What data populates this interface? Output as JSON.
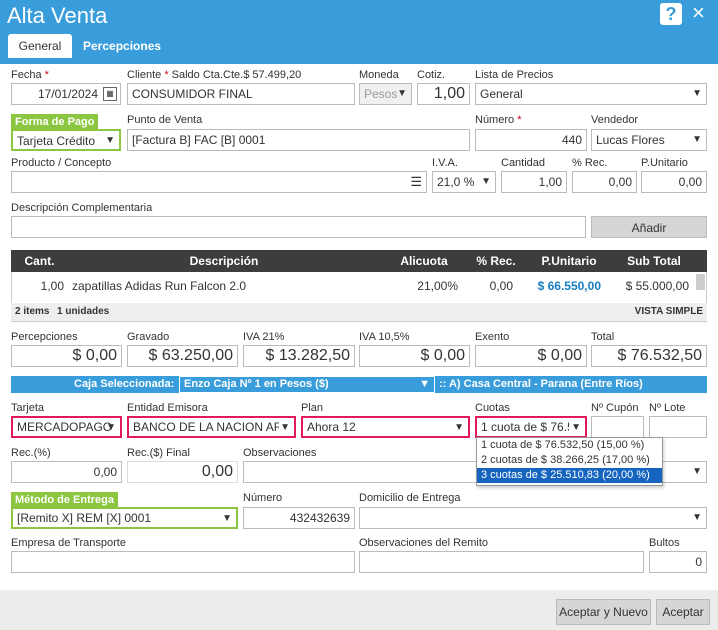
{
  "window": {
    "title": "Alta Venta",
    "help": "?",
    "close": "×"
  },
  "tabs": [
    "General",
    "Percepciones"
  ],
  "row1": {
    "fecha_label": "Fecha",
    "fecha_value": "17/01/2024",
    "cliente_label": "Cliente",
    "saldo": "Saldo Cta.Cte.$ 57.499,20",
    "cliente_value": "CONSUMIDOR FINAL",
    "moneda_label": "Moneda",
    "moneda_value": "Pesos",
    "cotiz_label": "Cotiz.",
    "cotiz_value": "1,00",
    "lista_label": "Lista de Precios",
    "lista_value": "General"
  },
  "row2": {
    "forma_label": "Forma de Pago",
    "forma_value": "Tarjeta Crédito",
    "pv_label": "Punto de Venta",
    "pv_value": "[Factura B] FAC [B] 0001",
    "numero_label": "Número",
    "numero_value": "440",
    "vendedor_label": "Vendedor",
    "vendedor_value": "Lucas Flores"
  },
  "row3": {
    "producto_label": "Producto / Concepto",
    "iva_label": "I.V.A.",
    "iva_value": "21,0 %",
    "cantidad_label": "Cantidad",
    "cantidad_value": "1,00",
    "rec_label": "% Rec.",
    "rec_value": "0,00",
    "punit_label": "P.Unitario",
    "punit_value": "0,00"
  },
  "row4": {
    "desc_label": "Descripción Complementaria",
    "add_button": "Añadir"
  },
  "table": {
    "headers": [
      "Cant.",
      "Descripción",
      "Alicuota",
      "% Rec.",
      "P.Unitario",
      "Sub Total"
    ],
    "rows": [
      {
        "cant": "1,00",
        "desc": "zapatillas Adidas Run Falcon 2.0",
        "alic": "21,00%",
        "rec": "0,00",
        "punit": "$ 66.550,00",
        "sub": "$ 55.000,00"
      }
    ],
    "summary_items": "2 items",
    "summary_units": "1 unidades",
    "view": "VISTA SIMPLE"
  },
  "totals": [
    {
      "label": "Percepciones",
      "value": "$ 0,00"
    },
    {
      "label": "Gravado",
      "value": "$ 63.250,00"
    },
    {
      "label": "IVA 21%",
      "value": "$ 13.282,50"
    },
    {
      "label": "IVA 10,5%",
      "value": "$ 0,00"
    },
    {
      "label": "Exento",
      "value": "$ 0,00"
    },
    {
      "label": "Total",
      "value": "$ 76.532,50"
    }
  ],
  "caja": {
    "label": "Caja Seleccionada:",
    "value": "Enzo Caja Nº 1 en Pesos ($)",
    "branch": ":: A) Casa Central - Parana (Entre Ríos)"
  },
  "card": {
    "tarjeta_label": "Tarjeta",
    "tarjeta_value": "MERCADOPAGO",
    "entidad_label": "Entidad Emisora",
    "entidad_value": "BANCO DE LA NACION ARG",
    "plan_label": "Plan",
    "plan_value": "Ahora 12",
    "cuotas_label": "Cuotas",
    "cuotas_value": "1 cuota de $ 76.5",
    "cupon_label": "Nº Cupón",
    "lote_label": "Nº Lote",
    "cuotas_options": [
      "1 cuota de $ 76.532,50 (15,00 %)",
      "2 cuotas de $ 38.266,25 (17,00 %)",
      "3 cuotas de $ 25.510,83 (20,00 %)"
    ]
  },
  "rec": {
    "rec_label": "Rec.(%)",
    "rec_value": "0,00",
    "recf_label": "Rec.($) Final",
    "recf_value": "0,00",
    "obs_label": "Observaciones"
  },
  "entrega": {
    "metodo_label": "Método de Entrega",
    "metodo_value": "[Remito X] REM [X] 0001",
    "numero_label": "Número",
    "numero_value": "432432639",
    "dom_label": "Domicilio de Entrega"
  },
  "transporte": {
    "empresa_label": "Empresa de Transporte",
    "obs_label": "Observaciones del Remito",
    "bultos_label": "Bultos",
    "bultos_value": "0"
  },
  "footer": {
    "accept_new": "Aceptar y Nuevo",
    "accept": "Aceptar"
  }
}
